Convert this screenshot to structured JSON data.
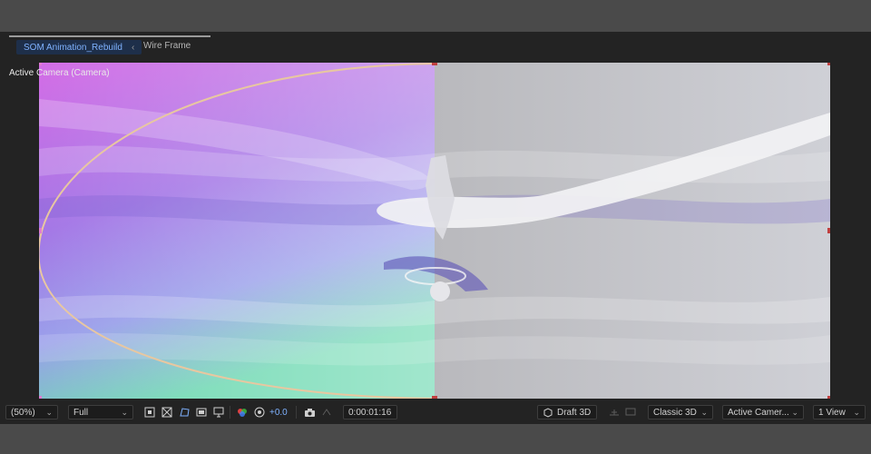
{
  "tabs": {
    "active": "SOM Animation_Rebuild",
    "inactive": "Wire Frame"
  },
  "viewer": {
    "camera_label": "Active Camera (Camera)"
  },
  "toolbar": {
    "zoom": "(50%)",
    "resolution": "Full",
    "exposure": "+0.0",
    "timecode": "0:00:01:16",
    "renderer_mode": "Draft 3D",
    "renderer": "Classic 3D",
    "view": "Active Camer...",
    "layout": "1 View"
  },
  "colors": {
    "accent": "#7fb2ff",
    "tab_active_bg": "#1e2f4a",
    "handle": "#c04040",
    "motion_path": "#e8c7a0"
  }
}
